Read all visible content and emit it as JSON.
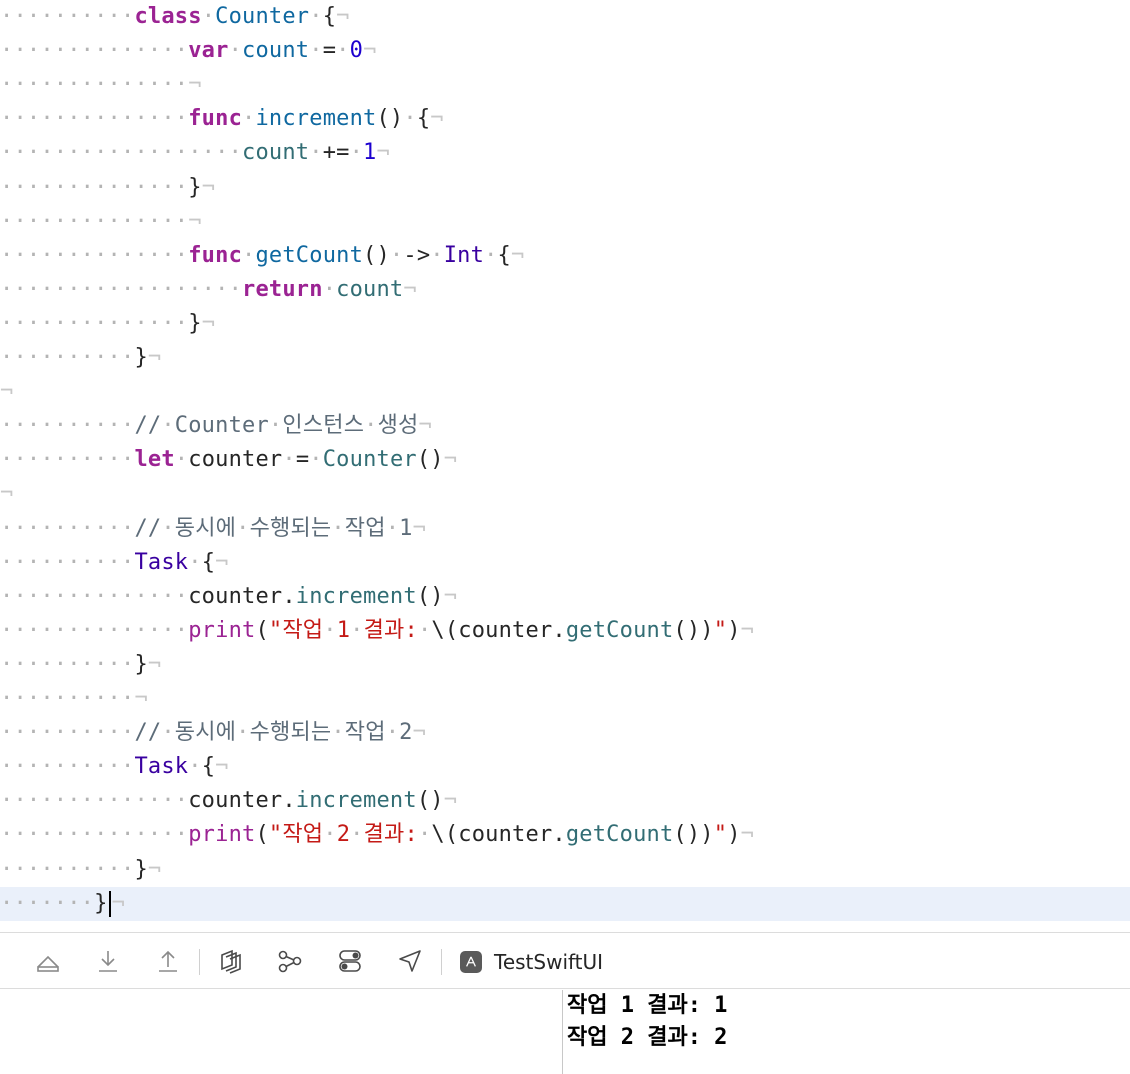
{
  "code_lines": [
    [
      {
        "c": "ws",
        "t": "··········"
      },
      {
        "c": "kw",
        "t": "class"
      },
      {
        "c": "ws",
        "t": "·"
      },
      {
        "c": "decl",
        "t": "Counter"
      },
      {
        "c": "ws",
        "t": "·"
      },
      {
        "c": "plain",
        "t": "{"
      },
      {
        "c": "nl",
        "t": "¬"
      }
    ],
    [
      {
        "c": "ws",
        "t": "··············"
      },
      {
        "c": "kw",
        "t": "var"
      },
      {
        "c": "ws",
        "t": "·"
      },
      {
        "c": "decl",
        "t": "count"
      },
      {
        "c": "ws",
        "t": "·"
      },
      {
        "c": "plain",
        "t": "="
      },
      {
        "c": "ws",
        "t": "·"
      },
      {
        "c": "num",
        "t": "0"
      },
      {
        "c": "nl",
        "t": "¬"
      }
    ],
    [
      {
        "c": "ws",
        "t": "··············"
      },
      {
        "c": "nl",
        "t": "¬"
      }
    ],
    [
      {
        "c": "ws",
        "t": "··············"
      },
      {
        "c": "kw",
        "t": "func"
      },
      {
        "c": "ws",
        "t": "·"
      },
      {
        "c": "decl",
        "t": "increment"
      },
      {
        "c": "plain",
        "t": "()"
      },
      {
        "c": "ws",
        "t": "·"
      },
      {
        "c": "plain",
        "t": "{"
      },
      {
        "c": "nl",
        "t": "¬"
      }
    ],
    [
      {
        "c": "ws",
        "t": "··················"
      },
      {
        "c": "ident",
        "t": "count"
      },
      {
        "c": "ws",
        "t": "·"
      },
      {
        "c": "plain",
        "t": "+="
      },
      {
        "c": "ws",
        "t": "·"
      },
      {
        "c": "num",
        "t": "1"
      },
      {
        "c": "nl",
        "t": "¬"
      }
    ],
    [
      {
        "c": "ws",
        "t": "··············"
      },
      {
        "c": "plain",
        "t": "}"
      },
      {
        "c": "nl",
        "t": "¬"
      }
    ],
    [
      {
        "c": "ws",
        "t": "··············"
      },
      {
        "c": "nl",
        "t": "¬"
      }
    ],
    [
      {
        "c": "ws",
        "t": "··············"
      },
      {
        "c": "kw",
        "t": "func"
      },
      {
        "c": "ws",
        "t": "·"
      },
      {
        "c": "decl",
        "t": "getCount"
      },
      {
        "c": "plain",
        "t": "()"
      },
      {
        "c": "ws",
        "t": "·"
      },
      {
        "c": "plain",
        "t": "->"
      },
      {
        "c": "ws",
        "t": "·"
      },
      {
        "c": "ty",
        "t": "Int"
      },
      {
        "c": "ws",
        "t": "·"
      },
      {
        "c": "plain",
        "t": "{"
      },
      {
        "c": "nl",
        "t": "¬"
      }
    ],
    [
      {
        "c": "ws",
        "t": "··················"
      },
      {
        "c": "kw",
        "t": "return"
      },
      {
        "c": "ws",
        "t": "·"
      },
      {
        "c": "ident",
        "t": "count"
      },
      {
        "c": "nl",
        "t": "¬"
      }
    ],
    [
      {
        "c": "ws",
        "t": "··············"
      },
      {
        "c": "plain",
        "t": "}"
      },
      {
        "c": "nl",
        "t": "¬"
      }
    ],
    [
      {
        "c": "ws",
        "t": "··········"
      },
      {
        "c": "plain",
        "t": "}"
      },
      {
        "c": "nl",
        "t": "¬"
      }
    ],
    [
      {
        "c": "nl",
        "t": "¬"
      }
    ],
    [
      {
        "c": "ws",
        "t": "··········"
      },
      {
        "c": "cmt",
        "t": "//"
      },
      {
        "c": "ws",
        "t": "·"
      },
      {
        "c": "cmt",
        "t": "Counter"
      },
      {
        "c": "ws",
        "t": "·"
      },
      {
        "c": "cmt",
        "t": "인스턴스"
      },
      {
        "c": "ws",
        "t": "·"
      },
      {
        "c": "cmt",
        "t": "생성"
      },
      {
        "c": "nl",
        "t": "¬"
      }
    ],
    [
      {
        "c": "ws",
        "t": "··········"
      },
      {
        "c": "kw",
        "t": "let"
      },
      {
        "c": "ws",
        "t": "·"
      },
      {
        "c": "plain",
        "t": "counter"
      },
      {
        "c": "ws",
        "t": "·"
      },
      {
        "c": "plain",
        "t": "="
      },
      {
        "c": "ws",
        "t": "·"
      },
      {
        "c": "ident",
        "t": "Counter"
      },
      {
        "c": "plain",
        "t": "()"
      },
      {
        "c": "nl",
        "t": "¬"
      }
    ],
    [
      {
        "c": "nl",
        "t": "¬"
      }
    ],
    [
      {
        "c": "ws",
        "t": "··········"
      },
      {
        "c": "cmt",
        "t": "//"
      },
      {
        "c": "ws",
        "t": "·"
      },
      {
        "c": "cmt",
        "t": "동시에"
      },
      {
        "c": "ws",
        "t": "·"
      },
      {
        "c": "cmt",
        "t": "수행되는"
      },
      {
        "c": "ws",
        "t": "·"
      },
      {
        "c": "cmt",
        "t": "작업"
      },
      {
        "c": "ws",
        "t": "·"
      },
      {
        "c": "cmt",
        "t": "1"
      },
      {
        "c": "nl",
        "t": "¬"
      }
    ],
    [
      {
        "c": "ws",
        "t": "··········"
      },
      {
        "c": "ty",
        "t": "Task"
      },
      {
        "c": "ws",
        "t": "·"
      },
      {
        "c": "plain",
        "t": "{"
      },
      {
        "c": "nl",
        "t": "¬"
      }
    ],
    [
      {
        "c": "ws",
        "t": "··············"
      },
      {
        "c": "plain",
        "t": "counter."
      },
      {
        "c": "fn",
        "t": "increment"
      },
      {
        "c": "plain",
        "t": "()"
      },
      {
        "c": "nl",
        "t": "¬"
      }
    ],
    [
      {
        "c": "ws",
        "t": "··············"
      },
      {
        "c": "kw2",
        "t": "print"
      },
      {
        "c": "plain",
        "t": "("
      },
      {
        "c": "str",
        "t": "\"작업"
      },
      {
        "c": "ws",
        "t": "·"
      },
      {
        "c": "str",
        "t": "1"
      },
      {
        "c": "ws",
        "t": "·"
      },
      {
        "c": "str",
        "t": "결과:"
      },
      {
        "c": "ws",
        "t": "·"
      },
      {
        "c": "plain",
        "t": "\\(counter."
      },
      {
        "c": "fn",
        "t": "getCount"
      },
      {
        "c": "plain",
        "t": "())"
      },
      {
        "c": "str",
        "t": "\""
      },
      {
        "c": "plain",
        "t": ")"
      },
      {
        "c": "nl",
        "t": "¬"
      }
    ],
    [
      {
        "c": "ws",
        "t": "··········"
      },
      {
        "c": "plain",
        "t": "}"
      },
      {
        "c": "nl",
        "t": "¬"
      }
    ],
    [
      {
        "c": "ws",
        "t": "··········"
      },
      {
        "c": "nl",
        "t": "¬"
      }
    ],
    [
      {
        "c": "ws",
        "t": "··········"
      },
      {
        "c": "cmt",
        "t": "//"
      },
      {
        "c": "ws",
        "t": "·"
      },
      {
        "c": "cmt",
        "t": "동시에"
      },
      {
        "c": "ws",
        "t": "·"
      },
      {
        "c": "cmt",
        "t": "수행되는"
      },
      {
        "c": "ws",
        "t": "·"
      },
      {
        "c": "cmt",
        "t": "작업"
      },
      {
        "c": "ws",
        "t": "·"
      },
      {
        "c": "cmt",
        "t": "2"
      },
      {
        "c": "nl",
        "t": "¬"
      }
    ],
    [
      {
        "c": "ws",
        "t": "··········"
      },
      {
        "c": "ty",
        "t": "Task"
      },
      {
        "c": "ws",
        "t": "·"
      },
      {
        "c": "plain",
        "t": "{"
      },
      {
        "c": "nl",
        "t": "¬"
      }
    ],
    [
      {
        "c": "ws",
        "t": "··············"
      },
      {
        "c": "plain",
        "t": "counter."
      },
      {
        "c": "fn",
        "t": "increment"
      },
      {
        "c": "plain",
        "t": "()"
      },
      {
        "c": "nl",
        "t": "¬"
      }
    ],
    [
      {
        "c": "ws",
        "t": "··············"
      },
      {
        "c": "kw2",
        "t": "print"
      },
      {
        "c": "plain",
        "t": "("
      },
      {
        "c": "str",
        "t": "\"작업"
      },
      {
        "c": "ws",
        "t": "·"
      },
      {
        "c": "str",
        "t": "2"
      },
      {
        "c": "ws",
        "t": "·"
      },
      {
        "c": "str",
        "t": "결과:"
      },
      {
        "c": "ws",
        "t": "·"
      },
      {
        "c": "plain",
        "t": "\\(counter."
      },
      {
        "c": "fn",
        "t": "getCount"
      },
      {
        "c": "plain",
        "t": "())"
      },
      {
        "c": "str",
        "t": "\""
      },
      {
        "c": "plain",
        "t": ")"
      },
      {
        "c": "nl",
        "t": "¬"
      }
    ],
    [
      {
        "c": "ws",
        "t": "··········"
      },
      {
        "c": "plain",
        "t": "}"
      },
      {
        "c": "nl",
        "t": "¬"
      }
    ],
    [
      {
        "c": "ws",
        "t": "·······"
      },
      {
        "c": "plain",
        "t": "}"
      },
      {
        "c": "caret",
        "t": ""
      },
      {
        "c": "nl",
        "t": "¬"
      }
    ]
  ],
  "current_line_index": 26,
  "debug_bar": {
    "buttons": [
      {
        "name": "hide-debug-area-button",
        "icon": "tray-icon"
      },
      {
        "name": "step-over-button",
        "icon": "step-down-icon"
      },
      {
        "name": "step-out-button",
        "icon": "step-up-icon"
      },
      {
        "name": "view-debugger-button",
        "icon": "layers-icon"
      },
      {
        "name": "memory-graph-button",
        "icon": "graph-icon"
      },
      {
        "name": "environment-overrides-button",
        "icon": "toggles-icon"
      },
      {
        "name": "simulate-location-button",
        "icon": "location-arrow-icon"
      }
    ],
    "scheme_label": "TestSwiftUI"
  },
  "console": {
    "output_lines": [
      "작업 1 결과: 1",
      "작업 2 결과: 2"
    ]
  },
  "colors": {
    "keyword": "#9b2393",
    "type": "#3900a0",
    "declaration": "#0f68a0",
    "identifier": "#326d74",
    "number": "#1c00cf",
    "string": "#c41a16",
    "comment": "#5d6c79",
    "current_line_bg": "#eaf0fa"
  }
}
